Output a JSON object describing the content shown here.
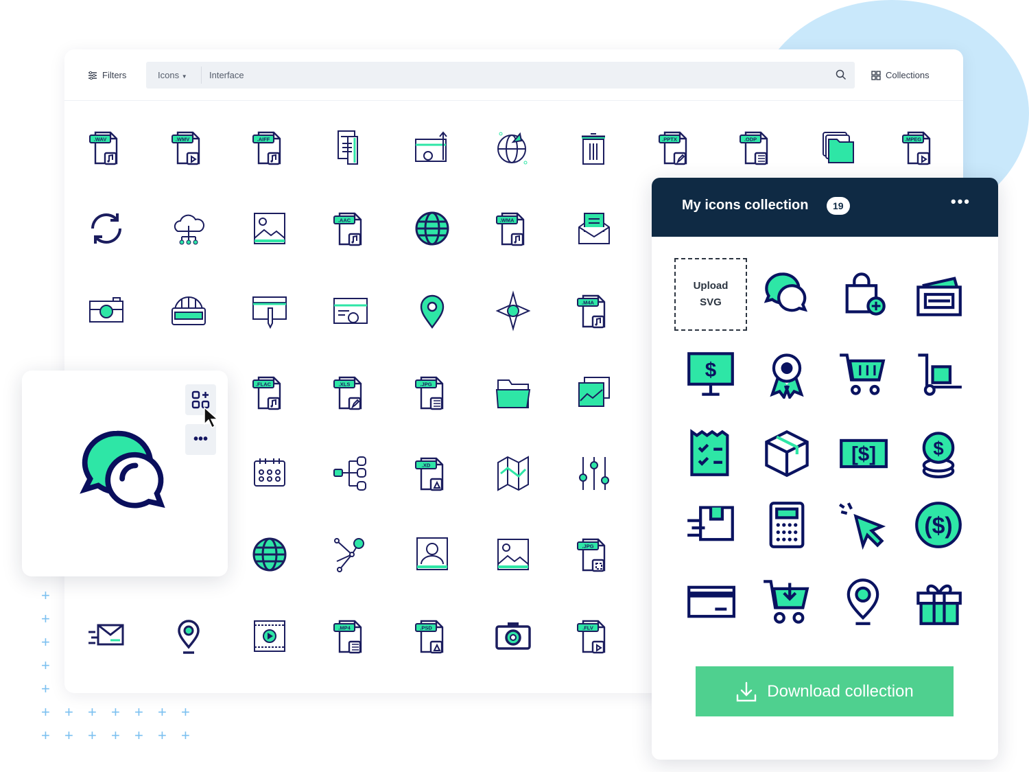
{
  "toolbar": {
    "filters": "Filters",
    "type_select": "Icons",
    "search_value": "Interface",
    "collections": "Collections"
  },
  "grid": [
    {
      "icon": "file",
      "label": ".WAV",
      "glyph": "music"
    },
    {
      "icon": "file",
      "label": ".WMV",
      "glyph": "play"
    },
    {
      "icon": "file",
      "label": ".AIFF",
      "glyph": "music"
    },
    {
      "icon": "document"
    },
    {
      "icon": "browser-growth"
    },
    {
      "icon": "globe-leaf"
    },
    {
      "icon": "trash"
    },
    {
      "icon": "file",
      "label": ".PPTX",
      "glyph": "pen"
    },
    {
      "icon": "file",
      "label": ".ODP",
      "glyph": "doc"
    },
    {
      "icon": "folders"
    },
    {
      "icon": "file",
      "label": ".MPEG",
      "glyph": "play"
    },
    {
      "icon": "refresh"
    },
    {
      "icon": "cloud-network"
    },
    {
      "icon": "image"
    },
    {
      "icon": "file",
      "label": ".AAC",
      "glyph": "music"
    },
    {
      "icon": "globe-filled"
    },
    {
      "icon": "file",
      "label": ".WMA",
      "glyph": "music"
    },
    {
      "icon": "mail-open"
    },
    {
      "icon": "camera-flat"
    },
    {
      "icon": "globe-window"
    },
    {
      "icon": "browser-pen"
    },
    {
      "icon": "browser-settings"
    },
    {
      "icon": "pin-green"
    },
    {
      "icon": "compass"
    },
    {
      "icon": "file",
      "label": ".M4A",
      "glyph": "music"
    },
    null,
    null,
    {
      "icon": "file",
      "label": ".FLAC",
      "glyph": "music"
    },
    {
      "icon": "file",
      "label": ".XLS",
      "glyph": "pen"
    },
    {
      "icon": "file",
      "label": ".JPG",
      "glyph": "doc"
    },
    {
      "icon": "folder"
    },
    {
      "icon": "images"
    },
    null,
    null,
    {
      "icon": "calendar"
    },
    {
      "icon": "tree"
    },
    {
      "icon": "file",
      "label": ".XD",
      "glyph": "triangle"
    },
    {
      "icon": "map"
    },
    {
      "icon": "sliders"
    },
    null,
    null,
    {
      "icon": "globe-filled"
    },
    {
      "icon": "nodes"
    },
    {
      "icon": "user-profile"
    },
    {
      "icon": "image"
    },
    {
      "icon": "file",
      "label": ".JPG",
      "glyph": "frame"
    },
    {
      "icon": "mail-fast"
    },
    {
      "icon": "pin"
    },
    {
      "icon": "video"
    },
    {
      "icon": "file",
      "label": ".MP4",
      "glyph": "doc"
    },
    {
      "icon": "file",
      "label": ".PSD",
      "glyph": "triangle"
    },
    {
      "icon": "camera"
    },
    {
      "icon": "file",
      "label": ".FLV",
      "glyph": "play"
    }
  ],
  "collection": {
    "title": "My icons collection",
    "count": "19",
    "upload_line1": "Upload",
    "upload_line2": "SVG",
    "icons": [
      "chat",
      "bag-add",
      "wallet",
      "monitor-dollar",
      "award",
      "cart",
      "trolley",
      "checklist",
      "box",
      "cash",
      "coins",
      "delivery",
      "calculator",
      "click",
      "dollar-circle",
      "credit-card",
      "cart-download",
      "pin",
      "gift"
    ],
    "download": "Download collection"
  },
  "colors": {
    "navy": "#141660",
    "green": "#2ee6a6",
    "panel_header": "#0f2a44",
    "button": "#4fd08f",
    "blob": "#c9e8fb"
  }
}
